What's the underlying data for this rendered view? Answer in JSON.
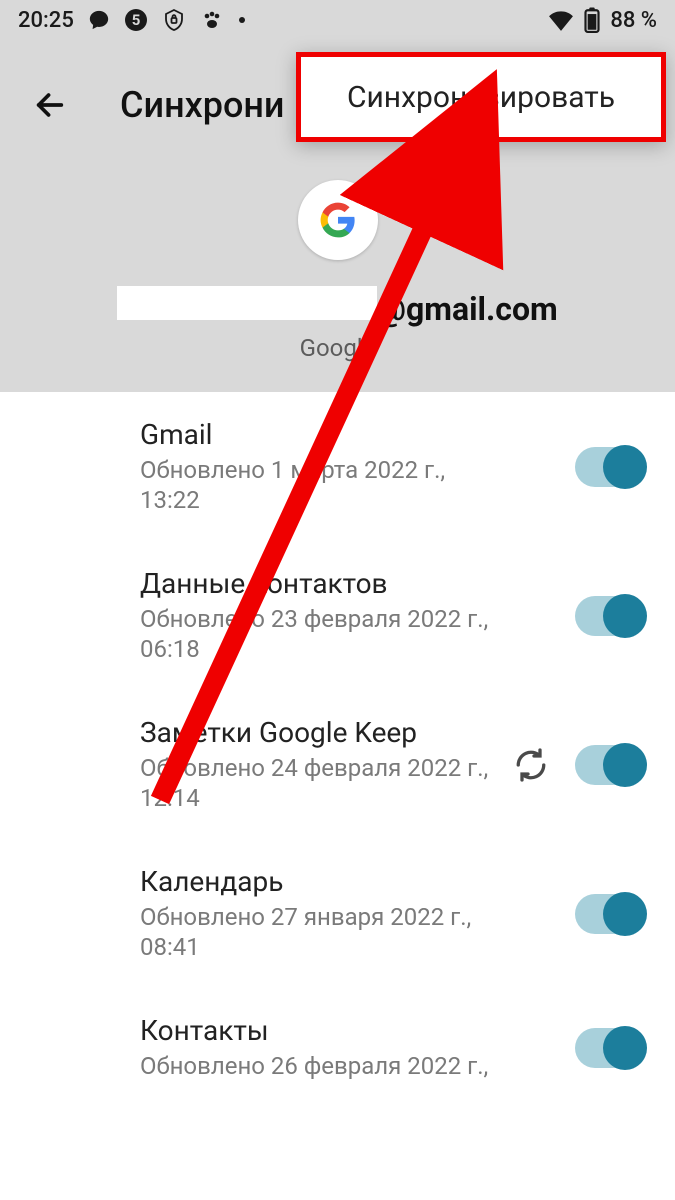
{
  "status": {
    "time": "20:25",
    "battery_text": "88 %"
  },
  "header": {
    "title": "Синхрони",
    "email_suffix": "@gmail.com",
    "provider": "Google"
  },
  "popup": {
    "label": "Синхронизировать"
  },
  "items": [
    {
      "title": "Gmail",
      "sub": "Обновлено 1 марта 2022 г., 13:22",
      "syncing": false
    },
    {
      "title": "Данные контактов",
      "sub": "Обновлено 23 февраля 2022 г., 06:18",
      "syncing": false
    },
    {
      "title": "Заметки Google Keep",
      "sub": "Обновлено 24 февраля 2022 г., 12:14",
      "syncing": true
    },
    {
      "title": "Календарь",
      "sub": "Обновлено 27 января 2022 г., 08:41",
      "syncing": false
    },
    {
      "title": "Контакты",
      "sub": "Обновлено 26 февраля 2022 г.,",
      "syncing": false
    }
  ]
}
